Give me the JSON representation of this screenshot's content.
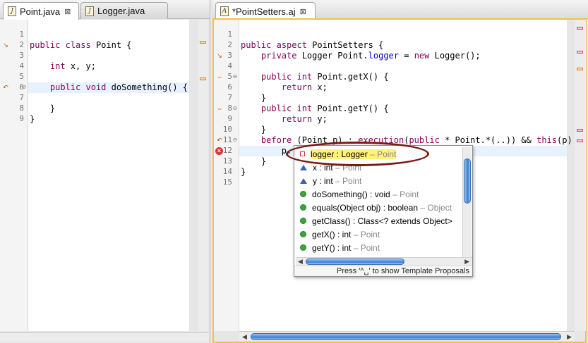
{
  "left_tabs": [
    {
      "label": "Point.java",
      "close": "⊠",
      "icon": "java-file-icon"
    },
    {
      "label": "Logger.java",
      "icon": "java-file-icon"
    }
  ],
  "right_tabs": [
    {
      "label": "*PointSetters.aj",
      "close": "⊠",
      "icon": "aspectj-file-icon"
    }
  ],
  "left_code": {
    "line_numbers": [
      "1",
      "2",
      "3",
      "4",
      "5",
      "6",
      "7",
      "8",
      "9"
    ],
    "lines": [
      "",
      "public class Point {",
      "",
      "    int x, y;",
      "",
      "    public void doSomething() {",
      "",
      "    }",
      "}"
    ]
  },
  "right_code": {
    "line_numbers": [
      "1",
      "2",
      "3",
      "4",
      "5",
      "6",
      "7",
      "8",
      "9",
      "10",
      "11",
      "12",
      "13",
      "14",
      "15"
    ],
    "lines": [
      "",
      "public aspect PointSetters {",
      "    private Logger Point.logger = new Logger();",
      "",
      "    public int Point.getX() {",
      "        return x;",
      "    }",
      "    public int Point.getY() {",
      "        return y;",
      "    }",
      "    before (Point p) : execution(public * Point.*(..)) && this(p)",
      "        p.",
      "    }",
      "}",
      ""
    ]
  },
  "proposals": [
    {
      "text": "logger : Logger",
      "owner": " – Point",
      "icon": "field-private-icon"
    },
    {
      "text": "x : int",
      "owner": " – Point",
      "icon": "field-default-icon"
    },
    {
      "text": "y : int",
      "owner": " – Point",
      "icon": "field-default-icon"
    },
    {
      "text": "doSomething() : void",
      "owner": " – Point",
      "icon": "method-public-icon"
    },
    {
      "text": "equals(Object obj) : boolean",
      "owner": " – Object",
      "icon": "method-public-icon"
    },
    {
      "text": "getClass() : Class<? extends Object>",
      "owner": "",
      "icon": "method-public-icon"
    },
    {
      "text": "getX() : int",
      "owner": " – Point",
      "icon": "method-public-icon"
    },
    {
      "text": "getY() : int",
      "owner": " – Point",
      "icon": "method-public-icon"
    }
  ],
  "popup_status": "Press '^␣' to show Template Proposals",
  "colors": {
    "keyword": "#7f0055",
    "field": "#0000c0",
    "selection": "#fff17a",
    "annotation": "#7a1a12"
  }
}
